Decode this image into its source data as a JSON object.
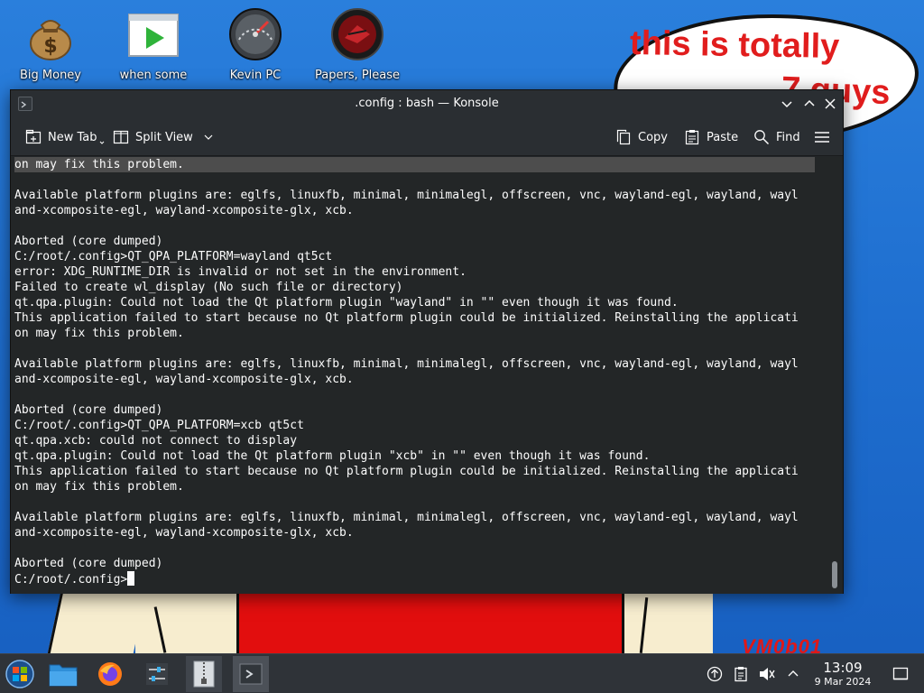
{
  "desktop": {
    "icons": [
      {
        "label": "Big Money"
      },
      {
        "label": "when some"
      },
      {
        "label": "Kevin PC"
      },
      {
        "label": "Papers, Please"
      }
    ],
    "wallpaper": {
      "bubble_line1": "this is totally",
      "bubble_line2": "7 guys",
      "signature": "VM0b01",
      "colors": {
        "sky": "#1f6fd0",
        "red": "#e20e0e",
        "skin": "#f7edcf"
      }
    }
  },
  "konsole": {
    "title": ".config : bash — Konsole",
    "toolbar": {
      "new_tab": "New Tab",
      "split_view": "Split View",
      "copy": "Copy",
      "paste": "Paste",
      "find": "Find"
    },
    "terminal_lines": [
      "on may fix this problem.",
      "",
      "Available platform plugins are: eglfs, linuxfb, minimal, minimalegl, offscreen, vnc, wayland-egl, wayland, wayl",
      "and-xcomposite-egl, wayland-xcomposite-glx, xcb.",
      "",
      "Aborted (core dumped)",
      "C:/root/.config>QT_QPA_PLATFORM=wayland qt5ct",
      "error: XDG_RUNTIME_DIR is invalid or not set in the environment.",
      "Failed to create wl_display (No such file or directory)",
      "qt.qpa.plugin: Could not load the Qt platform plugin \"wayland\" in \"\" even though it was found.",
      "This application failed to start because no Qt platform plugin could be initialized. Reinstalling the applicati",
      "on may fix this problem.",
      "",
      "Available platform plugins are: eglfs, linuxfb, minimal, minimalegl, offscreen, vnc, wayland-egl, wayland, wayl",
      "and-xcomposite-egl, wayland-xcomposite-glx, xcb.",
      "",
      "Aborted (core dumped)",
      "C:/root/.config>QT_QPA_PLATFORM=xcb qt5ct",
      "qt.qpa.xcb: could not connect to display",
      "qt.qpa.plugin: Could not load the Qt platform plugin \"xcb\" in \"\" even though it was found.",
      "This application failed to start because no Qt platform plugin could be initialized. Reinstalling the applicati",
      "on may fix this problem.",
      "",
      "Available platform plugins are: eglfs, linuxfb, minimal, minimalegl, offscreen, vnc, wayland-egl, wayland, wayl",
      "and-xcomposite-egl, wayland-xcomposite-glx, xcb.",
      "",
      "Aborted (core dumped)"
    ],
    "prompt": "C:/root/.config>",
    "colors": {
      "terminal_bg": "#232627",
      "text": "#fcfcfc",
      "chrome": "#2a2e32"
    }
  },
  "taskbar": {
    "launchers": [
      {
        "icon": "start-menu-icon"
      },
      {
        "icon": "file-manager-icon"
      },
      {
        "icon": "firefox-icon"
      },
      {
        "icon": "settings-icon"
      },
      {
        "icon": "archive-icon"
      },
      {
        "icon": "konsole-icon"
      }
    ],
    "clock": {
      "time": "13:09",
      "date": "9 Mar 2024"
    }
  }
}
